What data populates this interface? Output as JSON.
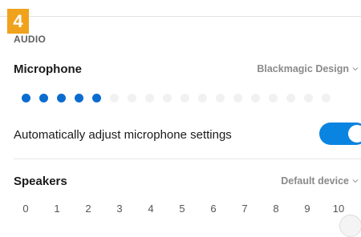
{
  "badge": {
    "step": "4"
  },
  "audio": {
    "section_title": "AUDIO",
    "microphone": {
      "label": "Microphone",
      "device": "Blackmagic Design",
      "level": {
        "active_dots": 5,
        "total_dots": 18
      }
    },
    "auto_adjust": {
      "label": "Automatically adjust microphone settings",
      "enabled": true
    },
    "speakers": {
      "label": "Speakers",
      "device": "Default device",
      "scale_ticks": [
        "0",
        "1",
        "2",
        "3",
        "4",
        "5",
        "6",
        "7",
        "8",
        "9",
        "10"
      ],
      "volume": 10
    }
  },
  "colors": {
    "accent": "#0a84e1",
    "level_active": "#0b6ccf",
    "badge": "#f0a21c"
  },
  "icons": {
    "dropdown": "chevron-down-icon"
  }
}
